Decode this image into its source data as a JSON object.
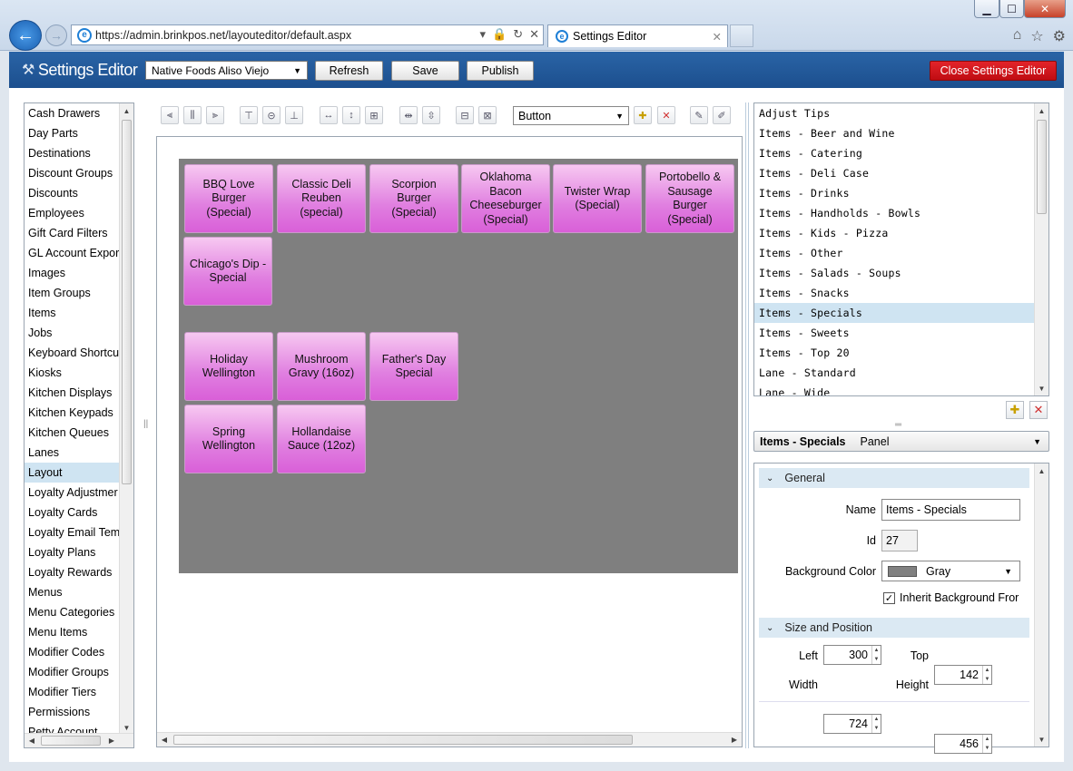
{
  "browser": {
    "url": "https://admin.brinkpos.net/layouteditor/default.aspx",
    "tab_title": "Settings Editor"
  },
  "app": {
    "title": "Settings Editor",
    "store": "Native Foods Aliso Viejo",
    "refresh_label": "Refresh",
    "save_label": "Save",
    "publish_label": "Publish",
    "close_label": "Close Settings Editor"
  },
  "left_nav": {
    "selected": "Layout",
    "items": [
      "Cash Drawers",
      "Day Parts",
      "Destinations",
      "Discount Groups",
      "Discounts",
      "Employees",
      "Gift Card Filters",
      "GL Account Expor",
      "Images",
      "Item Groups",
      "Items",
      "Jobs",
      "Keyboard Shortcu",
      "Kiosks",
      "Kitchen Displays",
      "Kitchen Keypads",
      "Kitchen Queues",
      "Lanes",
      "Layout",
      "Loyalty Adjustmer",
      "Loyalty Cards",
      "Loyalty Email Tem",
      "Loyalty Plans",
      "Loyalty Rewards",
      "Menus",
      "Menu Categories",
      "Menu Items",
      "Modifier Codes",
      "Modifier Groups",
      "Modifier Tiers",
      "Permissions",
      "Petty Account"
    ]
  },
  "toolbar": {
    "element_type": "Button"
  },
  "canvas": {
    "background_color": "#7f7f7f",
    "buttons": [
      {
        "label": "BBQ Love Burger (Special)"
      },
      {
        "label": "Classic Deli Reuben (special)"
      },
      {
        "label": "Scorpion Burger (Special)"
      },
      {
        "label": "Oklahoma Bacon Cheeseburger (Special)"
      },
      {
        "label": "Twister Wrap (Special)"
      },
      {
        "label": "Portobello & Sausage Burger (Special)"
      },
      {
        "label": "Chicago's Dip - Special"
      },
      {
        "label": "Holiday Wellington"
      },
      {
        "label": "Mushroom Gravy (16oz)"
      },
      {
        "label": "Father's Day Special"
      },
      {
        "label": "Spring Wellington"
      },
      {
        "label": "Hollandaise Sauce (12oz)"
      }
    ]
  },
  "panels_list": {
    "selected": "Items - Specials",
    "items": [
      "Adjust Tips",
      "Items - Beer and Wine",
      "Items - Catering",
      "Items - Deli Case",
      "Items - Drinks",
      "Items - Handholds - Bowls",
      "Items - Kids - Pizza",
      "Items - Other",
      "Items - Salads - Soups",
      "Items - Snacks",
      "Items - Specials",
      "Items - Sweets",
      "Items - Top 20",
      "Lane - Standard",
      "Lane - Wide"
    ]
  },
  "properties": {
    "header_name": "Items - Specials",
    "header_type": "Panel",
    "general_label": "General",
    "name_label": "Name",
    "name_value": "Items - Specials",
    "id_label": "Id",
    "id_value": "27",
    "bg_label": "Background Color",
    "bg_value": "Gray",
    "bg_swatch": "#808080",
    "inherit_label": "Inherit Background Fror",
    "inherit_checked": true,
    "size_label": "Size and Position",
    "left_label": "Left",
    "left_value": "300",
    "top_label": "Top",
    "top_value": "142",
    "width_label": "Width",
    "width_value": "724",
    "height_label": "Height",
    "height_value": "456"
  }
}
